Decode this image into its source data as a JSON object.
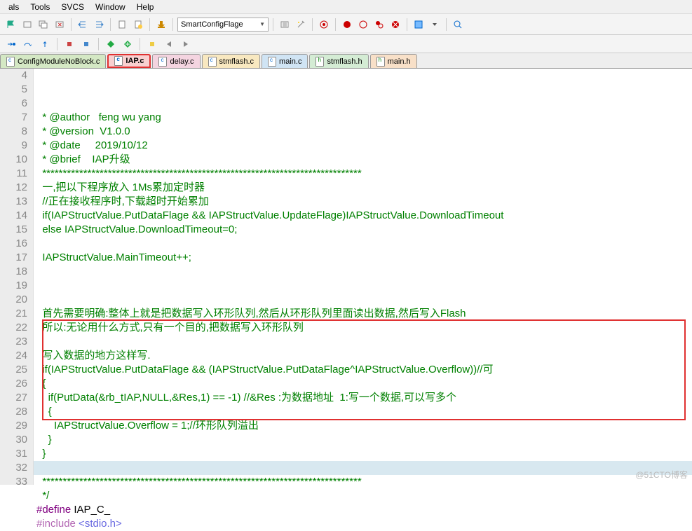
{
  "menu": {
    "items": [
      "als",
      "Tools",
      "SVCS",
      "Window",
      "Help"
    ]
  },
  "toolbar": {
    "combo": "SmartConfigFlage"
  },
  "tabs": [
    {
      "label": "ConfigModuleNoBlock.c",
      "cls": "t0",
      "h": false
    },
    {
      "label": "IAP.c",
      "cls": "t1",
      "h": false
    },
    {
      "label": "delay.c",
      "cls": "t2",
      "h": false
    },
    {
      "label": "stmflash.c",
      "cls": "t3",
      "h": false
    },
    {
      "label": "main.c",
      "cls": "t4",
      "h": false
    },
    {
      "label": "stmflash.h",
      "cls": "t5",
      "h": true
    },
    {
      "label": "main.h",
      "cls": "t6",
      "h": true
    }
  ],
  "startLine": 4,
  "lines": [
    "  * @author   feng wu yang",
    "  * @version  V1.0.0",
    "  * @date     2019/10/12",
    "  * @brief    IAP升级",
    "  ******************************************************************************",
    "  一,把以下程序放入 1Ms累加定时器",
    "  //正在接收程序时,下载超时开始累加",
    "  if(IAPStructValue.PutDataFlage && IAPStructValue.UpdateFlage)IAPStructValue.DownloadTimeout",
    "  else IAPStructValue.DownloadTimeout=0;",
    "",
    "  IAPStructValue.MainTimeout++;",
    "",
    "",
    "",
    "  首先需要明确:整体上就是把数据写入环形队列,然后从环形队列里面读出数据,然后写入Flash",
    "  所以:无论用什么方式,只有一个目的,把数据写入环形队列",
    "",
    "  写入数据的地方这样写.",
    "  if(IAPStructValue.PutDataFlage && (IAPStructValue.PutDataFlage^IAPStructValue.Overflow))//可",
    "  {",
    "    if(PutData(&rb_tIAP,NULL,&Res,1) == -1) //&Res :为数据地址  1:写一个数据,可以写多个",
    "    {",
    "      IAPStructValue.Overflow = 1;//环形队列溢出",
    "    }",
    "  }",
    "",
    "  ******************************************************************************",
    "  */"
  ],
  "line32": {
    "pre": "#define",
    "rest": " IAP_C_"
  },
  "line33": {
    "pre": "#include",
    "rest": " <stdio.h>"
  },
  "watermark": "@51CTO博客"
}
